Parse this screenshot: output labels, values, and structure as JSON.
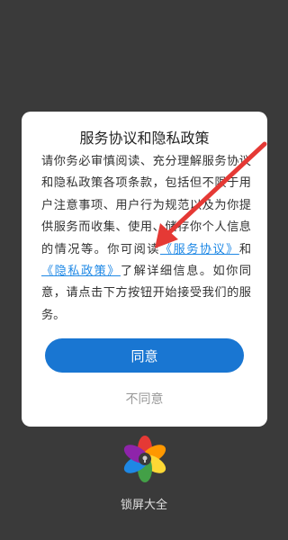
{
  "dialog": {
    "title": "服务协议和隐私政策",
    "body": {
      "intro": "请你务必审慎阅读、充分理解服务协议和隐私政策各项条款，包括但不限于用户注意事项、用户行为规范以及为你提供服务而收集、使用、储存你个人信息的情况等。你可阅读",
      "link_service": "《服务协议》",
      "connector": "和",
      "link_privacy": "《隐私政策》",
      "outro": "了解详细信息。如你同意，请点击下方按钮开始接受我们的服务。"
    },
    "agree_label": "同意",
    "disagree_label": "不同意"
  },
  "background_app": {
    "name": "锁屏大全",
    "logo_icon": "flower-lock-icon"
  },
  "overlay": {
    "arrow_icon": "red-arrow-icon",
    "arrow_color": "#e53935"
  },
  "colors": {
    "accent": "#1976d2",
    "link": "#1e88e5",
    "overlay": "#3a3a3a"
  }
}
